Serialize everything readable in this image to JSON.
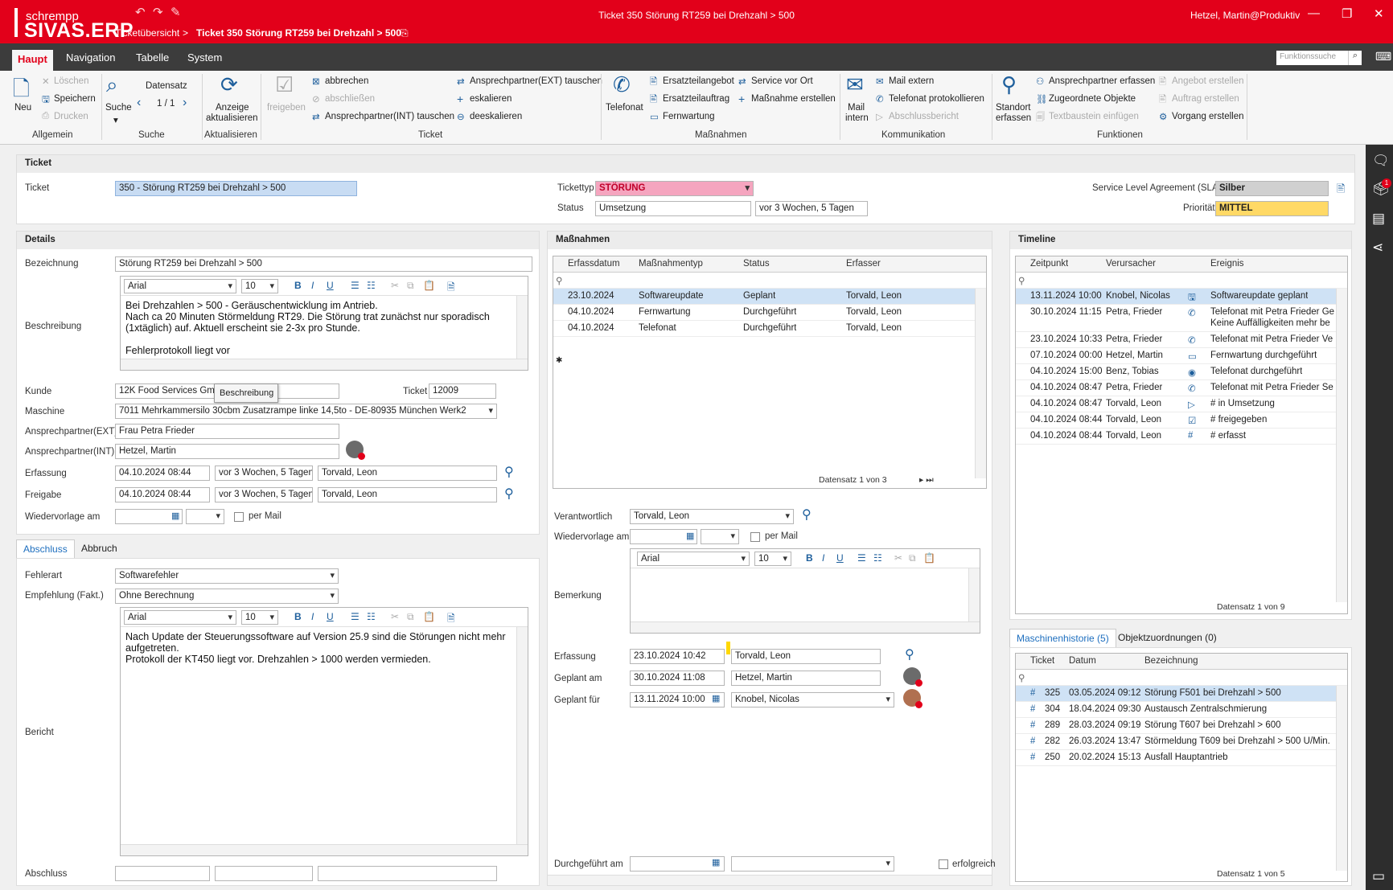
{
  "app": {
    "brand_small": "schrempp",
    "brand_big": "SIVAS.ERP",
    "window_title": "Ticket 350 Störung RT259 bei Drehzahl > 500",
    "user": "Hetzel, Martin@Produktiv"
  },
  "breadcrumb": {
    "root": "Ticketübersicht",
    "sep": ">",
    "current": "Ticket 350 Störung RT259 bei Drehzahl > 500"
  },
  "menu": {
    "items": [
      "Haupt",
      "Navigation",
      "Tabelle",
      "System"
    ],
    "search_placeholder": "Funktionssuche"
  },
  "ribbon": {
    "allgemein": {
      "neu": "Neu",
      "loeschen": "Löschen",
      "speichern": "Speichern",
      "drucken": "Drucken",
      "group": "Allgemein"
    },
    "suche": {
      "suche": "Suche",
      "datensatz": "Datensatz",
      "count": "1 / 1",
      "group": "Suche"
    },
    "aktualisieren": {
      "label1": "Anzeige",
      "label2": "aktualisieren",
      "group": "Aktualisieren"
    },
    "ticket": {
      "freigeben": "freigeben",
      "abbrechen": "abbrechen",
      "abschliessen": "abschließen",
      "int_tauschen": "Ansprechpartner(INT) tauschen",
      "ext_tauschen": "Ansprechpartner(EXT) tauschen",
      "eskalieren": "eskalieren",
      "deeskalieren": "deeskalieren",
      "group": "Ticket"
    },
    "massnahmen": {
      "telefonat": "Telefonat",
      "ersatzteilangebot": "Ersatzteilangebot",
      "ersatzteilauftrag": "Ersatzteilauftrag",
      "fernwartung": "Fernwartung",
      "service_vor_ort": "Service vor Ort",
      "massnahme_erstellen": "Maßnahme erstellen",
      "group": "Maßnahmen"
    },
    "kommunikation": {
      "mail_intern1": "Mail",
      "mail_intern2": "intern",
      "mail_extern": "Mail extern",
      "telefonat_prot": "Telefonat protokollieren",
      "abschlussbericht": "Abschlussbericht",
      "group": "Kommunikation"
    },
    "funktionen": {
      "standort1": "Standort",
      "standort2": "erfassen",
      "textbaustein": "Textbaustein einfügen",
      "ap_erfassen": "Ansprechpartner erfassen",
      "zugeordnete": "Zugeordnete Objekte",
      "vorgang": "Vorgang erstellen",
      "angebot": "Angebot erstellen",
      "auftrag": "Auftrag erstellen",
      "group": "Funktionen"
    }
  },
  "ticket": {
    "header": "Ticket",
    "label": "Ticket",
    "value": "350 - Störung RT259 bei Drehzahl > 500",
    "typ_label": "Tickettyp",
    "typ_value": "STÖRUNG",
    "status_label": "Status",
    "status_value": "Umsetzung",
    "status_since": "vor 3 Wochen, 5 Tagen",
    "sla_label": "Service Level Agreement (SLA)",
    "sla_value": "Silber",
    "prio_label": "Priorität",
    "prio_value": "MITTEL"
  },
  "details": {
    "header": "Details",
    "bezeichnung_label": "Bezeichnung",
    "bezeichnung": "Störung RT259 bei Drehzahl > 500",
    "beschreibung_label": "Beschreibung",
    "font": "Arial",
    "size": "10",
    "beschreibung_text": "Bei Drehzahlen > 500 - Geräuschentwicklung im Antrieb.\nNach ca 20 Minuten Störmeldung RT29. Die Störung trat zunächst nur sporadisch\n(1xtäglich) auf. Aktuell erscheint sie 2-3x pro Stunde.\n\nFehlerprotokoll liegt vor",
    "kunde_label": "Kunde",
    "kunde": "12K Food Services GmbH - München",
    "tooltip": "Beschreibung",
    "ticket_label": "Ticket",
    "ticket_nr": "12009",
    "maschine_label": "Maschine",
    "maschine": "7011 Mehrkammersilo 30cbm Zusatzrampe linke 14,5to - DE-80935 München Werk2",
    "ext_label": "Ansprechpartner(EXT)",
    "ext": "Frau Petra Frieder",
    "int_label": "Ansprechpartner(INT)",
    "int": "Hetzel, Martin",
    "erfassung_label": "Erfassung",
    "erfassung_date": "04.10.2024 08:44",
    "erfassung_rel": "vor 3 Wochen, 5 Tagen",
    "erfassung_user": "Torvald, Leon",
    "freigabe_label": "Freigabe",
    "freigabe_date": "04.10.2024 08:44",
    "freigabe_rel": "vor 3 Wochen, 5 Tagen",
    "freigabe_user": "Torvald, Leon",
    "wiedervorlage_label": "Wiedervorlage am",
    "per_mail": "per Mail"
  },
  "abschluss": {
    "tabs": [
      "Abschluss",
      "Abbruch"
    ],
    "fehlerart_label": "Fehlerart",
    "fehlerart": "Softwarefehler",
    "empfehlung_label": "Empfehlung (Fakt.)",
    "empfehlung": "Ohne Berechnung",
    "bericht_label": "Bericht",
    "bericht_text": "Nach Update der Steuerungssoftware auf Version 25.9 sind die Störungen nicht mehr\naufgetreten.\nProtokoll der KT450 liegt vor. Drehzahlen > 1000 werden vermieden.",
    "abschluss_label": "Abschluss"
  },
  "massnahmen": {
    "header": "Maßnahmen",
    "cols": [
      "Erfassdatum",
      "Maßnahmentyp",
      "Status",
      "Erfasser"
    ],
    "rows": [
      [
        "23.10.2024",
        "Softwareupdate",
        "Geplant",
        "Torvald, Leon"
      ],
      [
        "04.10.2024",
        "Fernwartung",
        "Durchgeführt",
        "Torvald, Leon"
      ],
      [
        "04.10.2024",
        "Telefonat",
        "Durchgeführt",
        "Torvald, Leon"
      ]
    ],
    "pager": "Datensatz 1 von 3",
    "verantwortlich_label": "Verantwortlich",
    "verantwortlich": "Torvald, Leon",
    "wiedervorlage_label": "Wiedervorlage am",
    "per_mail": "per Mail",
    "bemerkung_label": "Bemerkung",
    "erfassung_label": "Erfassung",
    "erfassung_date": "23.10.2024 10:42",
    "erfassung_user": "Torvald, Leon",
    "geplant_am_label": "Geplant am",
    "geplant_am_date": "30.10.2024 11:08",
    "geplant_am_user": "Hetzel, Martin",
    "geplant_fuer_label": "Geplant für",
    "geplant_fuer_date": "13.11.2024 10:00",
    "geplant_fuer_user": "Knobel, Nicolas",
    "durchgefuehrt_label": "Durchgeführt am",
    "erfolgreich": "erfolgreich"
  },
  "timeline": {
    "header": "Timeline",
    "cols": [
      "Zeitpunkt",
      "Verursacher",
      "Ereignis"
    ],
    "rows": [
      {
        "t": "13.11.2024 10:00",
        "v": "Knobel, Nicolas",
        "i": "🖫",
        "e": "Softwareupdate geplant",
        "e2": ""
      },
      {
        "t": "30.10.2024 11:15",
        "v": "Petra, Frieder",
        "i": "✆",
        "e": "Telefonat mit Petra Frieder Ge",
        "e2": "Keine Auffälligkeiten mehr be"
      },
      {
        "t": "23.10.2024 10:33",
        "v": "Petra, Frieder",
        "i": "✆",
        "e": "Telefonat mit Petra Frieder Ve",
        "e2": ""
      },
      {
        "t": "07.10.2024 00:00",
        "v": "Hetzel, Martin",
        "i": "▭",
        "e": "Fernwartung durchgeführt",
        "e2": ""
      },
      {
        "t": "04.10.2024 15:00",
        "v": "Benz, Tobias",
        "i": "◉",
        "e": "Telefonat durchgeführt",
        "e2": ""
      },
      {
        "t": "04.10.2024 08:47",
        "v": "Petra, Frieder",
        "i": "✆",
        "e": "Telefonat mit Petra Frieder Se",
        "e2": ""
      },
      {
        "t": "04.10.2024 08:47",
        "v": "Torvald, Leon",
        "i": "▷",
        "e": "# in Umsetzung",
        "e2": ""
      },
      {
        "t": "04.10.2024 08:44",
        "v": "Torvald, Leon",
        "i": "☑",
        "e": "# freigegeben",
        "e2": ""
      },
      {
        "t": "04.10.2024 08:44",
        "v": "Torvald, Leon",
        "i": "#",
        "e": "# erfasst",
        "e2": ""
      }
    ],
    "pager": "Datensatz 1 von 9"
  },
  "historie": {
    "tabs": [
      "Maschinenhistorie (5)",
      "Objektzuordnungen (0)"
    ],
    "cols": [
      "Ticket",
      "Datum",
      "Bezeichnung"
    ],
    "rows": [
      [
        "325",
        "03.05.2024 09:12",
        "Störung F501 bei Drehzahl > 500"
      ],
      [
        "304",
        "18.04.2024 09:30",
        "Austausch Zentralschmierung"
      ],
      [
        "289",
        "28.03.2024 09:19",
        "Störung T607 bei Drehzahl > 600"
      ],
      [
        "282",
        "26.03.2024 13:47",
        "Störmeldung T609 bei Drehzahl > 500 U/Min."
      ],
      [
        "250",
        "20.02.2024 15:13",
        "Ausfall Hauptantrieb"
      ]
    ],
    "pager": "Datensatz 1 von 5"
  }
}
